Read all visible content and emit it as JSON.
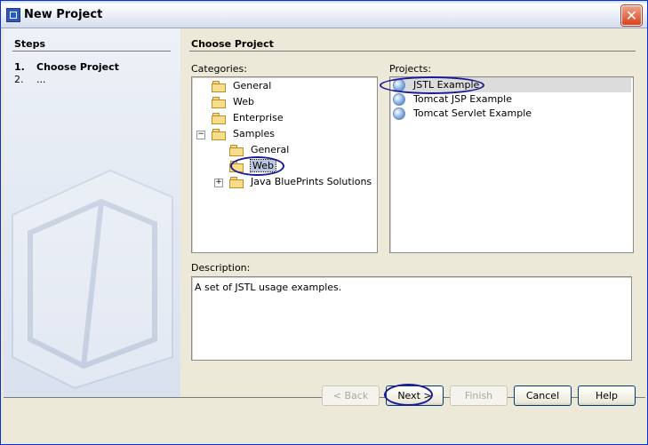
{
  "window": {
    "title": "New Project",
    "close_glyph": "✕"
  },
  "steps": {
    "heading": "Steps",
    "items": [
      {
        "number": "1.",
        "label": "Choose Project"
      },
      {
        "number": "2.",
        "label": "..."
      }
    ]
  },
  "main": {
    "heading": "Choose Project",
    "categories_label": "Categories:",
    "projects_label": "Projects:",
    "description_label": "Description:",
    "categories": [
      {
        "label": "General"
      },
      {
        "label": "Web"
      },
      {
        "label": "Enterprise"
      },
      {
        "label": "Samples",
        "expander": "−"
      },
      {
        "label": "General"
      },
      {
        "label": "Web",
        "selected": true
      },
      {
        "label": "Java BluePrints Solutions",
        "expander": "+"
      }
    ],
    "projects": [
      {
        "label": "JSTL Example",
        "selected": true
      },
      {
        "label": "Tomcat JSP Example"
      },
      {
        "label": "Tomcat Servlet Example"
      }
    ],
    "description": "A set of JSTL usage examples."
  },
  "buttons": {
    "back": "< Back",
    "next": "Next >",
    "finish": "Finish",
    "cancel": "Cancel",
    "help": "Help"
  },
  "colors": {
    "title_bar_accent": "#0831d9",
    "selection": "#b9c6de",
    "annotation_ring": "#1a1a9a"
  }
}
